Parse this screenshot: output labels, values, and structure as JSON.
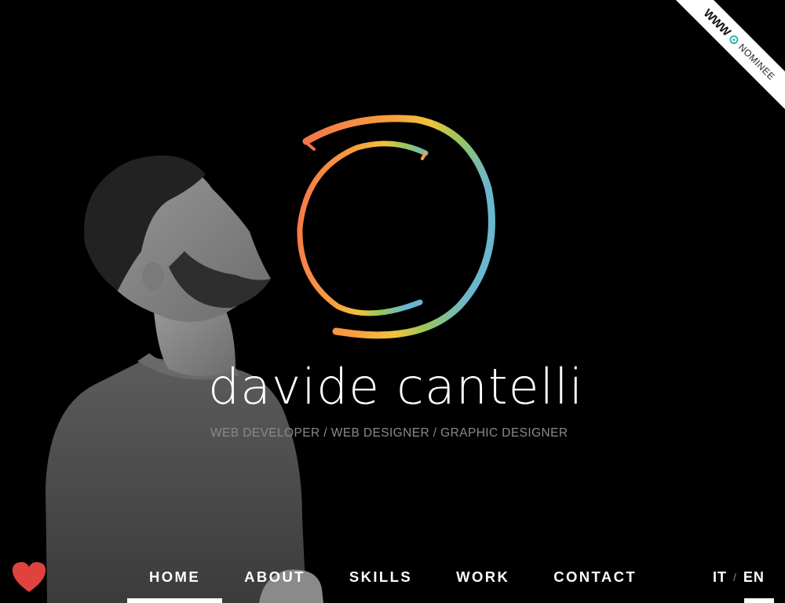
{
  "site": {
    "name": "davide cantelli",
    "tagline": "WEB DEVELOPER / WEB DESIGNER / GRAPHIC DESIGNER"
  },
  "ribbon": {
    "www": "WWW",
    "label": "NOMINEE",
    "accent": "#29b7b0"
  },
  "nav": {
    "items": [
      {
        "label": "HOME",
        "active": true
      },
      {
        "label": "ABOUT",
        "active": false
      },
      {
        "label": "SKILLS",
        "active": false
      },
      {
        "label": "WORK",
        "active": false
      },
      {
        "label": "CONTACT",
        "active": false
      }
    ]
  },
  "lang": {
    "it": "IT",
    "separator": "/",
    "en": "EN",
    "active": "EN"
  },
  "icons": {
    "heart": "heart-icon",
    "logo": "circle-logo-icon"
  },
  "colors": {
    "background": "#000000",
    "heart": "#e0433e",
    "logo_gradient": [
      "#f5744a",
      "#f7a13e",
      "#f2c33d",
      "#9ac75a",
      "#6bb6cf"
    ]
  }
}
